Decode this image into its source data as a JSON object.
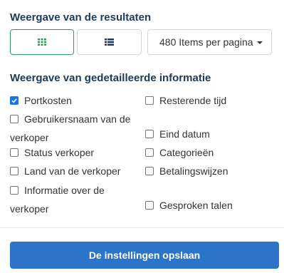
{
  "results_view": {
    "heading": "Weergave van de resultaten",
    "grid_icon": "grid-icon",
    "list_icon": "list-icon",
    "items_per_page": "480 Items per pagina",
    "accent_color": "#2e9e56"
  },
  "detail_view": {
    "heading": "Weergave van gedetailleerde informatie",
    "left_options": [
      {
        "label": "Portkosten",
        "checked": true
      },
      {
        "label": "Gebruikersnaam van de verkoper",
        "checked": false
      },
      {
        "label": "Status verkoper",
        "checked": false
      },
      {
        "label": "Land van de verkoper",
        "checked": false
      },
      {
        "label": "Informatie over de verkoper",
        "checked": false
      }
    ],
    "right_options": [
      {
        "label": "Resterende tijd",
        "checked": false
      },
      {
        "label": "Eind datum",
        "checked": false
      },
      {
        "label": "Categorieën",
        "checked": false
      },
      {
        "label": "Betalingswijzen",
        "checked": false
      },
      {
        "label": "Gesproken talen",
        "checked": false
      }
    ]
  },
  "save_button": {
    "label": "De instellingen opslaan",
    "color": "#2b74c8"
  }
}
